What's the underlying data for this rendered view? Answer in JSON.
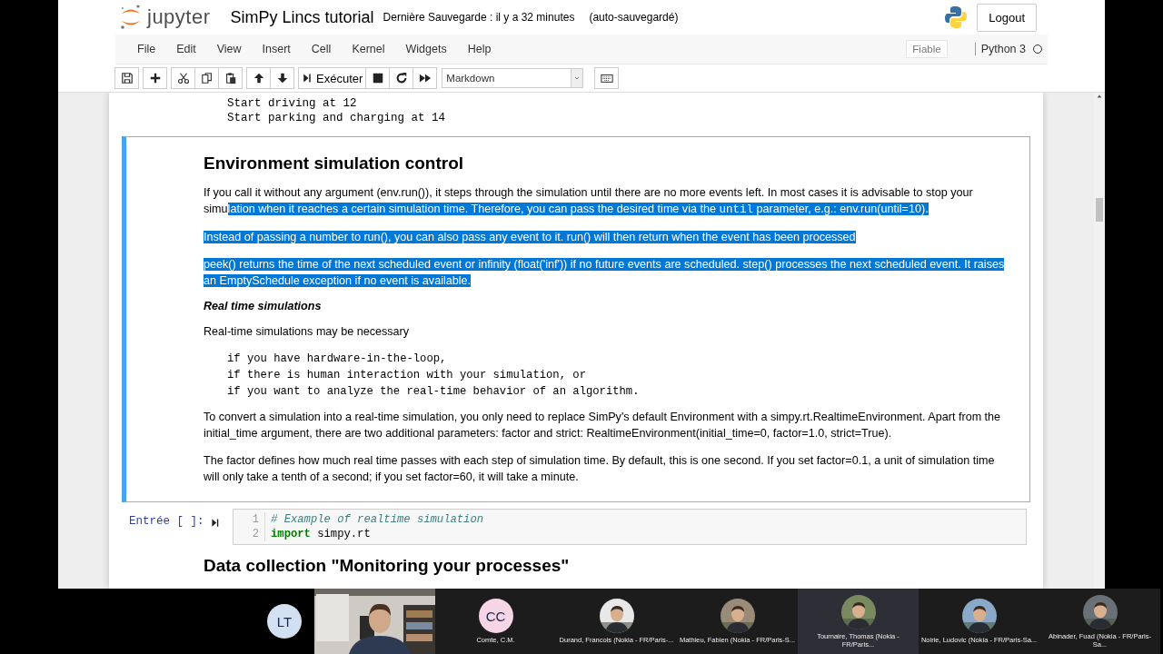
{
  "header": {
    "logo_text": "jupyter",
    "title": "SimPy Lincs tutorial",
    "checkpoint": "Dernière Sauvegarde : il y a 32 minutes",
    "autosave": "(auto-sauvegardé)",
    "logout": "Logout"
  },
  "menu": [
    "File",
    "Edit",
    "View",
    "Insert",
    "Cell",
    "Kernel",
    "Widgets",
    "Help"
  ],
  "trusted": "Fiable",
  "kernel": "Python 3",
  "kernel_busy": false,
  "toolbar": {
    "run": "Exécuter",
    "cell_type": "Markdown"
  },
  "output_lines": [
    "Start driving at 12",
    "Start parking and charging at 14"
  ],
  "markdown_cell": {
    "selected": true,
    "heading": "Environment simulation control",
    "blocks": [
      {
        "kind": "paragraph",
        "segments": [
          {
            "text": "If you call it without any argument (env.run()), it steps through the simulation until there are no more events left. In most cases it is advisable to stop your simu",
            "selected": false
          },
          {
            "text": "lation when it reaches a certain simulation time. Therefore, you can pass the desired time via the ",
            "selected": true
          },
          {
            "text": "until",
            "selected": true,
            "kind": "code"
          },
          {
            "text": " parameter, e.g.: env.run(until=10).",
            "selected": true
          }
        ]
      },
      {
        "kind": "paragraph",
        "segments": [
          {
            "text": "Instead of passing a number to run(), you can also pass any event to it. run() will then return when the event has been processed",
            "selected": true
          }
        ]
      },
      {
        "kind": "paragraph",
        "segments": [
          {
            "text": "peek() returns the time of the next scheduled event or infinity (float('inf')) if no future events are scheduled. step() processes the next scheduled event. It raises an EmptySchedule exception if no event is available.",
            "selected": true
          }
        ]
      },
      {
        "kind": "subheading",
        "text": "Real time simulations"
      },
      {
        "kind": "paragraph",
        "segments": [
          {
            "text": "Real-time simulations may be necessary",
            "selected": false
          }
        ]
      },
      {
        "kind": "pre",
        "lines": [
          "if you have hardware-in-the-loop,",
          "if there is human interaction with your simulation, or",
          "if you want to analyze the real-time behavior of an algorithm."
        ]
      },
      {
        "kind": "paragraph",
        "segments": [
          {
            "text": "To convert a simulation into a real-time simulation, you only need to replace SimPy's default Environment with a simpy.rt.RealtimeEnvironment. Apart from the initial_time argument, there are two additional parameters: factor and strict: RealtimeEnvironment(initial_time=0, factor=1.0, strict=True).",
            "selected": false
          }
        ]
      },
      {
        "kind": "paragraph",
        "segments": [
          {
            "text": "The factor defines how much real time passes with each step of simulation time. By default, this is one second. If you set factor=0.1, a unit of simulation time will only take a tenth of a second; if you set factor=60, it will take a minute.",
            "selected": false
          }
        ]
      }
    ]
  },
  "code_cell": {
    "selected": false,
    "prompt": "Entrée [ ]:",
    "lines": [
      {
        "number": "1",
        "tokens": [
          {
            "kind": "comment",
            "text": "# Example of realtime simulation"
          }
        ]
      },
      {
        "number": "2",
        "tokens": [
          {
            "kind": "keyword",
            "text": "import"
          },
          {
            "kind": "plain",
            "text": " simpy.rt"
          }
        ]
      }
    ]
  },
  "next_heading": "Data collection \"Monitoring your processes\"",
  "participants": [
    {
      "kind": "initials",
      "initials": "LT",
      "color": "#d3e0f1",
      "speaking": false
    },
    {
      "kind": "video"
    },
    {
      "kind": "initials",
      "initials": "CC",
      "color": "#f5d5e6",
      "name": "Comte, C.M.",
      "speaking": false
    },
    {
      "name": "Durand, Francois (Nokia - FR/Paris-...",
      "speaking": false
    },
    {
      "name": "Mathieu, Fabien (Nokia - FR/Paris-S...",
      "speaking": false
    },
    {
      "name": "Tournaire, Thomas (Nokia - FR/Paris...",
      "speaking": true
    },
    {
      "name": "Noirie, Ludovic (Nokia - FR/Paris-Sa...",
      "speaking": false
    },
    {
      "name": "Abinader, Fuad (Nokia - FR/Paris-Sa...",
      "speaking": false
    }
  ]
}
